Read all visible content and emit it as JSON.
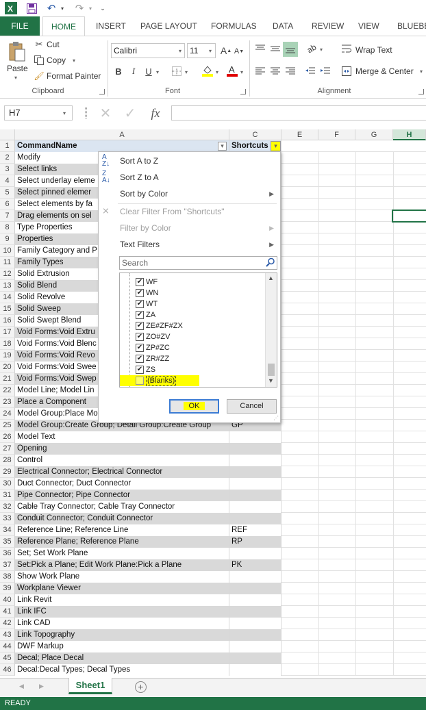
{
  "tabs": {
    "file": "FILE",
    "home": "HOME",
    "insert": "INSERT",
    "page_layout": "PAGE LAYOUT",
    "formulas": "FORMULAS",
    "data": "DATA",
    "review": "REVIEW",
    "view": "VIEW",
    "bluebeam": "BLUEBEA"
  },
  "clipboard": {
    "paste": "Paste",
    "cut": "Cut",
    "copy": "Copy",
    "format_painter": "Format Painter",
    "title": "Clipboard"
  },
  "font": {
    "name": "Calibri",
    "size": "11",
    "title": "Font"
  },
  "alignment": {
    "wrap_text": "Wrap Text",
    "merge_center": "Merge & Center",
    "title": "Alignment"
  },
  "formula_bar": {
    "name_box": "H7",
    "fx": "fx"
  },
  "columns": [
    "A",
    "C",
    "E",
    "F",
    "G",
    "H"
  ],
  "header_row": {
    "a": "CommandName",
    "c": "Shortcuts"
  },
  "rows": [
    {
      "n": "2",
      "a": "Modify",
      "c": ""
    },
    {
      "n": "3",
      "a": "Select links",
      "c": ""
    },
    {
      "n": "4",
      "a": "Select underlay eleme",
      "c": ""
    },
    {
      "n": "5",
      "a": "Select pinned elemer",
      "c": ""
    },
    {
      "n": "6",
      "a": "Select elements by fa",
      "c": ""
    },
    {
      "n": "7",
      "a": "Drag elements on sel",
      "c": ""
    },
    {
      "n": "8",
      "a": "Type Properties",
      "c": ""
    },
    {
      "n": "9",
      "a": "Properties",
      "c": ""
    },
    {
      "n": "10",
      "a": "Family Category and P",
      "c": ""
    },
    {
      "n": "11",
      "a": "Family Types",
      "c": ""
    },
    {
      "n": "12",
      "a": "Solid Extrusion",
      "c": ""
    },
    {
      "n": "13",
      "a": "Solid Blend",
      "c": ""
    },
    {
      "n": "14",
      "a": "Solid Revolve",
      "c": ""
    },
    {
      "n": "15",
      "a": "Solid Sweep",
      "c": ""
    },
    {
      "n": "16",
      "a": "Solid Swept Blend",
      "c": ""
    },
    {
      "n": "17",
      "a": "Void Forms:Void Extru",
      "c": ""
    },
    {
      "n": "18",
      "a": "Void Forms:Void Blenc",
      "c": ""
    },
    {
      "n": "19",
      "a": "Void Forms:Void Revo",
      "c": ""
    },
    {
      "n": "20",
      "a": "Void Forms:Void Swee",
      "c": ""
    },
    {
      "n": "21",
      "a": "Void Forms:Void Swep",
      "c": ""
    },
    {
      "n": "22",
      "a": "Model Line; Model Lin",
      "c": ""
    },
    {
      "n": "23",
      "a": "Place a Component",
      "c": ""
    },
    {
      "n": "24",
      "a": "Model Group:Place Mo",
      "c": ""
    },
    {
      "n": "25",
      "a": "Model Group:Create Group; Detail Group:Create Group",
      "c": "GP"
    },
    {
      "n": "26",
      "a": "Model Text",
      "c": ""
    },
    {
      "n": "27",
      "a": "Opening",
      "c": ""
    },
    {
      "n": "28",
      "a": "Control",
      "c": ""
    },
    {
      "n": "29",
      "a": "Electrical Connector; Electrical Connector",
      "c": ""
    },
    {
      "n": "30",
      "a": "Duct Connector; Duct Connector",
      "c": ""
    },
    {
      "n": "31",
      "a": "Pipe Connector; Pipe Connector",
      "c": ""
    },
    {
      "n": "32",
      "a": "Cable Tray Connector; Cable Tray Connector",
      "c": ""
    },
    {
      "n": "33",
      "a": "Conduit Connector; Conduit Connector",
      "c": ""
    },
    {
      "n": "34",
      "a": "Reference Line; Reference Line",
      "c": "REF"
    },
    {
      "n": "35",
      "a": "Reference Plane; Reference Plane",
      "c": "RP"
    },
    {
      "n": "36",
      "a": "Set; Set Work Plane",
      "c": ""
    },
    {
      "n": "37",
      "a": "Set:Pick a Plane; Edit Work Plane:Pick a Plane",
      "c": "PK"
    },
    {
      "n": "38",
      "a": "Show Work Plane",
      "c": ""
    },
    {
      "n": "39",
      "a": "Workplane Viewer",
      "c": ""
    },
    {
      "n": "40",
      "a": "Link Revit",
      "c": ""
    },
    {
      "n": "41",
      "a": "Link IFC",
      "c": ""
    },
    {
      "n": "42",
      "a": "Link CAD",
      "c": ""
    },
    {
      "n": "43",
      "a": "Link Topography",
      "c": ""
    },
    {
      "n": "44",
      "a": "DWF Markup",
      "c": ""
    },
    {
      "n": "45",
      "a": "Decal; Place Decal",
      "c": ""
    },
    {
      "n": "46",
      "a": "Decal:Decal Types; Decal Types",
      "c": ""
    }
  ],
  "filter_menu": {
    "sort_az": "Sort A to Z",
    "sort_za": "Sort Z to A",
    "sort_color": "Sort by Color",
    "clear_filter": "Clear Filter From \"Shortcuts\"",
    "filter_color": "Filter by Color",
    "text_filters": "Text Filters",
    "search_placeholder": "Search",
    "items": [
      {
        "label": "WF",
        "checked": true
      },
      {
        "label": "WN",
        "checked": true
      },
      {
        "label": "WT",
        "checked": true
      },
      {
        "label": "ZA",
        "checked": true
      },
      {
        "label": "ZE#ZF#ZX",
        "checked": true
      },
      {
        "label": "ZO#ZV",
        "checked": true
      },
      {
        "label": "ZP#ZC",
        "checked": true
      },
      {
        "label": "ZR#ZZ",
        "checked": true
      },
      {
        "label": "ZS",
        "checked": true
      },
      {
        "label": "(Blanks)",
        "checked": false
      }
    ],
    "ok": "OK",
    "cancel": "Cancel"
  },
  "sheet_tab": "Sheet1",
  "status": "READY",
  "colors": {
    "excel_green": "#217346",
    "highlight": "#ffff00",
    "band": "#d9d9d9"
  }
}
